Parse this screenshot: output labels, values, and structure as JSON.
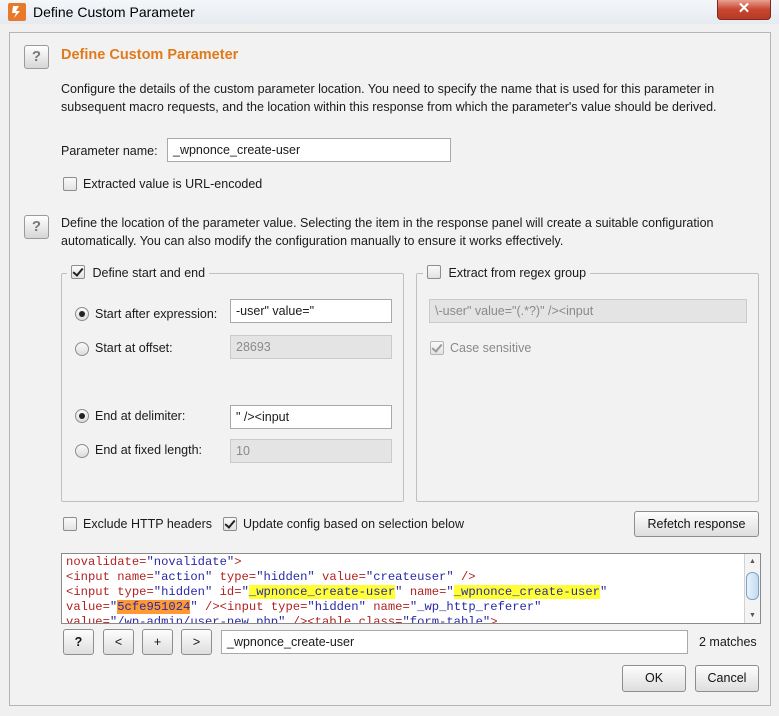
{
  "window": {
    "title": "Define Custom Parameter",
    "close_glyph": "✕"
  },
  "help_label": "?",
  "section1": {
    "heading": "Define Custom Parameter",
    "description": "Configure the details of the custom parameter location. You need to specify the name that is used for this parameter in subsequent macro requests, and the location within this response from which the parameter's value should be derived."
  },
  "param": {
    "name_label": "Parameter name:",
    "name_value": "_wpnonce_create-user",
    "url_encoded_label": "Extracted value is URL-encoded",
    "url_encoded_checked": false
  },
  "section2": {
    "description": "Define the location of the parameter value. Selecting the item in the response panel will create a suitable configuration automatically. You can also modify the configuration manually to ensure it works effectively."
  },
  "start_end": {
    "legend": "Define start and end",
    "checked": true,
    "start_after_label": "Start after expression:",
    "start_after_value": "-user\" value=\"",
    "start_offset_label": "Start at offset:",
    "start_offset_value": "28693",
    "end_delimiter_label": "End at delimiter:",
    "end_delimiter_value": "\" /><input",
    "end_fixed_label": "End at fixed length:",
    "end_fixed_value": "10"
  },
  "regex": {
    "legend": "Extract from regex group",
    "checked": false,
    "expression": "\\-user\" value=\"(.*?)\" /><input",
    "case_sensitive_label": "Case sensitive",
    "case_sensitive_checked": true
  },
  "options": {
    "exclude_headers_label": "Exclude HTTP headers",
    "exclude_headers_checked": false,
    "update_config_label": "Update config based on selection below",
    "update_config_checked": true,
    "refetch_label": "Refetch response"
  },
  "response_lines": [
    [
      {
        "t": "novalidate=",
        "c": "attr"
      },
      {
        "t": "\"novalidate\"",
        "c": "val"
      },
      {
        "t": ">",
        "c": "tag"
      }
    ],
    [
      {
        "t": "<input ",
        "c": "tag"
      },
      {
        "t": "name=",
        "c": "attr"
      },
      {
        "t": "\"action\"",
        "c": "val"
      },
      {
        "t": " type=",
        "c": "attr"
      },
      {
        "t": "\"hidden\"",
        "c": "val"
      },
      {
        "t": " value=",
        "c": "attr"
      },
      {
        "t": "\"createuser\"",
        "c": "val"
      },
      {
        "t": " />",
        "c": "tag"
      }
    ],
    [
      {
        "t": "<input ",
        "c": "tag"
      },
      {
        "t": "type=",
        "c": "attr"
      },
      {
        "t": "\"hidden\"",
        "c": "val"
      },
      {
        "t": " id=",
        "c": "attr"
      },
      {
        "t": "\"",
        "c": "val"
      },
      {
        "t": "_wpnonce_create-user",
        "c": "val hl-y"
      },
      {
        "t": "\"",
        "c": "val"
      },
      {
        "t": " name=",
        "c": "attr"
      },
      {
        "t": "\"",
        "c": "val"
      },
      {
        "t": "_wpnonce_create-user",
        "c": "val hl-y"
      },
      {
        "t": "\"",
        "c": "val"
      }
    ],
    [
      {
        "t": "value=",
        "c": "attr"
      },
      {
        "t": "\"",
        "c": "val"
      },
      {
        "t": "5cfe951024",
        "c": "val hl-o"
      },
      {
        "t": "\"",
        "c": "val"
      },
      {
        "t": " /><input ",
        "c": "tag"
      },
      {
        "t": "type=",
        "c": "attr"
      },
      {
        "t": "\"hidden\"",
        "c": "val"
      },
      {
        "t": " name=",
        "c": "attr"
      },
      {
        "t": "\"_wp_http_referer\"",
        "c": "val"
      }
    ],
    [
      {
        "t": "value=",
        "c": "attr"
      },
      {
        "t": "\"/wp-admin/user-new.php\"",
        "c": "val"
      },
      {
        "t": " /><table ",
        "c": "tag"
      },
      {
        "t": "class=",
        "c": "attr"
      },
      {
        "t": "\"form-table\"",
        "c": "val"
      },
      {
        "t": ">",
        "c": "tag"
      }
    ]
  ],
  "search": {
    "help": "?",
    "prev": "<",
    "add": "+",
    "next": ">",
    "value": "_wpnonce_create-user",
    "matches": "2 matches"
  },
  "footer": {
    "ok_label": "OK",
    "cancel_label": "Cancel"
  }
}
